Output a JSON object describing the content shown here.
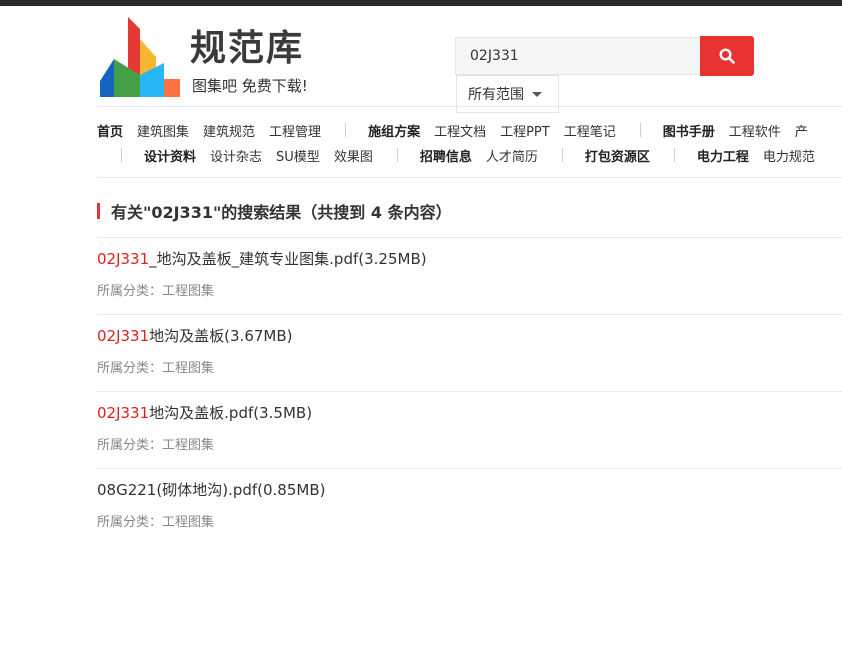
{
  "colors": {
    "accent": "#e93333",
    "highlight": "#e02020",
    "text": "#333333",
    "muted": "#888888",
    "topbar": "#2b2b2b"
  },
  "logo": {
    "title": "规范库",
    "slogan": "图集吧 免费下载!",
    "icon": "building-logo-icon"
  },
  "search": {
    "value": "02J331",
    "button_icon": "search-icon",
    "scope": "所有范围",
    "scope_icon": "caret-down-icon"
  },
  "nav": {
    "row1": [
      {
        "label": "首页",
        "bold": true
      },
      {
        "label": "建筑图集"
      },
      {
        "label": "建筑规范"
      },
      {
        "label": "工程管理"
      },
      {
        "sep": true
      },
      {
        "label": "施组方案",
        "bold": true
      },
      {
        "label": "工程文档"
      },
      {
        "label": "工程PPT"
      },
      {
        "label": "工程笔记"
      },
      {
        "sep": true
      },
      {
        "label": "图书手册",
        "bold": true
      },
      {
        "label": "工程软件"
      },
      {
        "label": "产"
      }
    ],
    "row2": [
      {
        "sep": true,
        "first": true
      },
      {
        "label": "设计资料",
        "bold": true
      },
      {
        "label": "设计杂志"
      },
      {
        "label": "SU模型"
      },
      {
        "label": "效果图"
      },
      {
        "sep": true
      },
      {
        "label": "招聘信息",
        "bold": true
      },
      {
        "label": "人才简历"
      },
      {
        "sep": true
      },
      {
        "label": "打包资源区",
        "bold": true
      },
      {
        "sep": true
      },
      {
        "label": "电力工程",
        "bold": true
      },
      {
        "label": "电力规范"
      }
    ]
  },
  "results": {
    "heading": "有关\"02J331\"的搜索结果（共搜到 4 条内容）",
    "category_label": "所属分类：",
    "items": [
      {
        "highlight": "02J331",
        "title": "_地沟及盖板_建筑专业图集.pdf(3.25MB)",
        "category": "工程图集"
      },
      {
        "highlight": "02J331",
        "title": "地沟及盖板(3.67MB)",
        "category": "工程图集"
      },
      {
        "highlight": "02J331",
        "title": "地沟及盖板.pdf(3.5MB)",
        "category": "工程图集"
      },
      {
        "highlight": "",
        "title": "08G221(砌体地沟).pdf(0.85MB)",
        "category": "工程图集"
      }
    ]
  }
}
